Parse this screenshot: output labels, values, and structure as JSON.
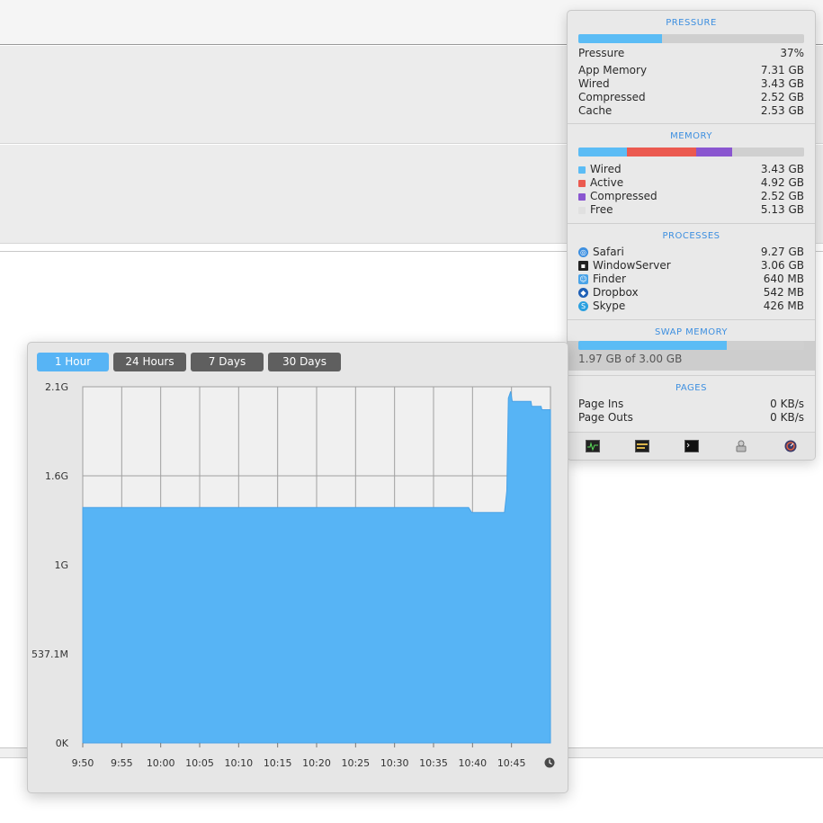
{
  "colors": {
    "accent": "#3d8fe0",
    "chart_fill": "#57b4f5",
    "wired": "#5bbcf5",
    "active": "#eb5a50",
    "compressed": "#8a56d0",
    "free": "#d0d0d0"
  },
  "panel": {
    "pressure": {
      "title": "PRESSURE",
      "bar_fraction": 0.37,
      "rows": [
        {
          "label": "Pressure",
          "value": "37%"
        },
        {
          "label": "App Memory",
          "value": "7.31 GB"
        },
        {
          "label": "Wired",
          "value": "3.43 GB"
        },
        {
          "label": "Compressed",
          "value": "2.52 GB"
        },
        {
          "label": "Cache",
          "value": "2.53 GB"
        }
      ]
    },
    "memory": {
      "title": "MEMORY",
      "rows": [
        {
          "label": "Wired",
          "value": "3.43 GB",
          "color": "#5bbcf5",
          "gb": 3.43
        },
        {
          "label": "Active",
          "value": "4.92 GB",
          "color": "#eb5a50",
          "gb": 4.92
        },
        {
          "label": "Compressed",
          "value": "2.52 GB",
          "color": "#8a56d0",
          "gb": 2.52
        },
        {
          "label": "Free",
          "value": "5.13 GB",
          "color": "#d0d0d0",
          "gb": 5.13
        }
      ]
    },
    "processes": {
      "title": "PROCESSES",
      "rows": [
        {
          "label": "Safari",
          "value": "9.27 GB",
          "icon": "safari-icon"
        },
        {
          "label": "WindowServer",
          "value": "3.06 GB",
          "icon": "windowserver-icon"
        },
        {
          "label": "Finder",
          "value": "640 MB",
          "icon": "finder-icon"
        },
        {
          "label": "Dropbox",
          "value": "542 MB",
          "icon": "dropbox-icon"
        },
        {
          "label": "Skype",
          "value": "426 MB",
          "icon": "skype-icon"
        }
      ]
    },
    "swap": {
      "title": "SWAP MEMORY",
      "bar_fraction": 0.657,
      "text": "1.97 GB of 3.00 GB"
    },
    "pages": {
      "title": "PAGES",
      "rows": [
        {
          "label": "Page Ins",
          "value": "0 KB/s"
        },
        {
          "label": "Page Outs",
          "value": "0 KB/s"
        }
      ]
    },
    "toolbar": [
      "activity-monitor-icon",
      "console-icon",
      "terminal-icon",
      "disk-utility-icon",
      "system-info-icon"
    ]
  },
  "chart_window": {
    "tabs": [
      {
        "label": "1 Hour",
        "active": true
      },
      {
        "label": "24 Hours",
        "active": false
      },
      {
        "label": "7 Days",
        "active": false
      },
      {
        "label": "30 Days",
        "active": false
      }
    ],
    "clock_icon": "clock-icon"
  },
  "chart_data": {
    "type": "area",
    "y_tick_labels": [
      "0K",
      "537.1M",
      "1G",
      "1.6G",
      "2.1G"
    ],
    "y_ticks_gb": [
      0,
      0.537,
      1.074,
      1.611,
      2.148
    ],
    "x_tick_labels": [
      "9:50",
      "9:55",
      "10:00",
      "10:05",
      "10:10",
      "10:15",
      "10:20",
      "10:25",
      "10:30",
      "10:35",
      "10:40",
      "10:45"
    ],
    "x_range_minutes": [
      0,
      60
    ],
    "ylim_gb": [
      0,
      2.148
    ],
    "grid": true,
    "series": [
      {
        "points": [
          [
            0,
            1.42
          ],
          [
            49.5,
            1.42
          ],
          [
            49.9,
            1.39
          ],
          [
            54.1,
            1.39
          ],
          [
            54.4,
            1.52
          ],
          [
            54.6,
            2.08
          ],
          [
            54.9,
            2.12
          ],
          [
            55.1,
            2.06
          ],
          [
            57.5,
            2.06
          ],
          [
            57.6,
            2.03
          ],
          [
            58.8,
            2.03
          ],
          [
            58.9,
            2.01
          ],
          [
            60,
            2.01
          ]
        ]
      }
    ]
  }
}
